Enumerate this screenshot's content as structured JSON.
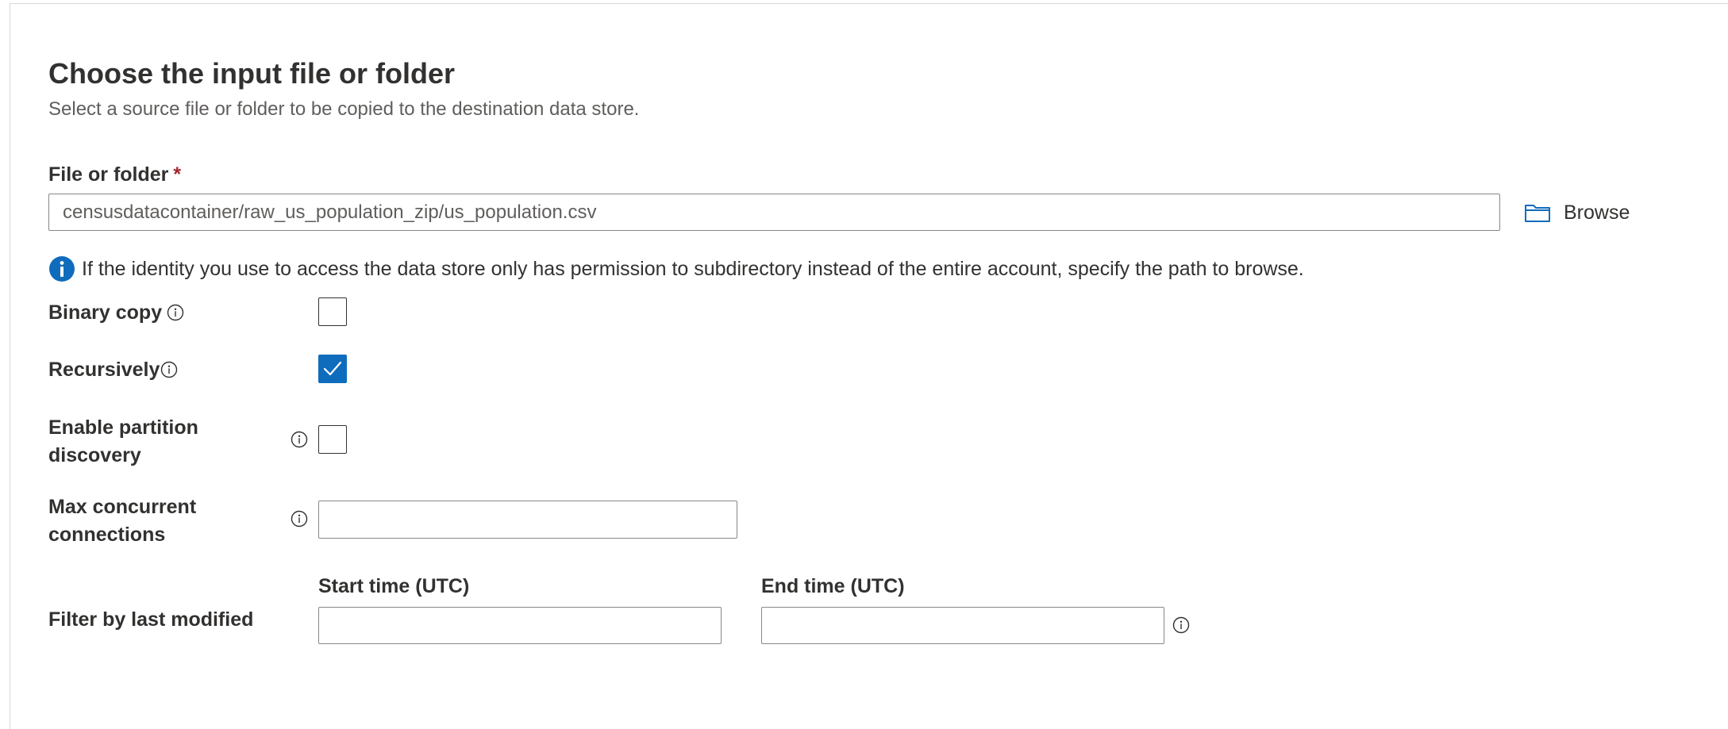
{
  "header": {
    "title": "Choose the input file or folder",
    "subtitle": "Select a source file or folder to be copied to the destination data store."
  },
  "file_or_folder": {
    "label": "File or folder",
    "required_marker": "*",
    "value": "censusdatacontainer/raw_us_population_zip/us_population.csv",
    "browse_label": "Browse"
  },
  "info_banner": {
    "text": "If the identity you use to access the data store only has permission to subdirectory instead of the entire account, specify the path to browse."
  },
  "options": {
    "binary_copy": {
      "label": "Binary copy",
      "checked": false
    },
    "recursively": {
      "label": "Recursively",
      "checked": true
    },
    "partition_discovery": {
      "label": "Enable partition discovery",
      "checked": false
    },
    "max_concurrent_connections": {
      "label": "Max concurrent connections",
      "value": ""
    }
  },
  "filter": {
    "label": "Filter by last modified",
    "start_label": "Start time (UTC)",
    "start_value": "",
    "end_label": "End time (UTC)",
    "end_value": ""
  },
  "icons": {
    "folder": "folder-icon",
    "info_filled": "info-filled-icon",
    "info": "info-icon",
    "check": "checkmark-icon"
  },
  "colors": {
    "accent": "#0f6cbd",
    "required": "#a4262c",
    "text": "#323130",
    "secondary_text": "#605e5c",
    "border": "#8a8886"
  }
}
